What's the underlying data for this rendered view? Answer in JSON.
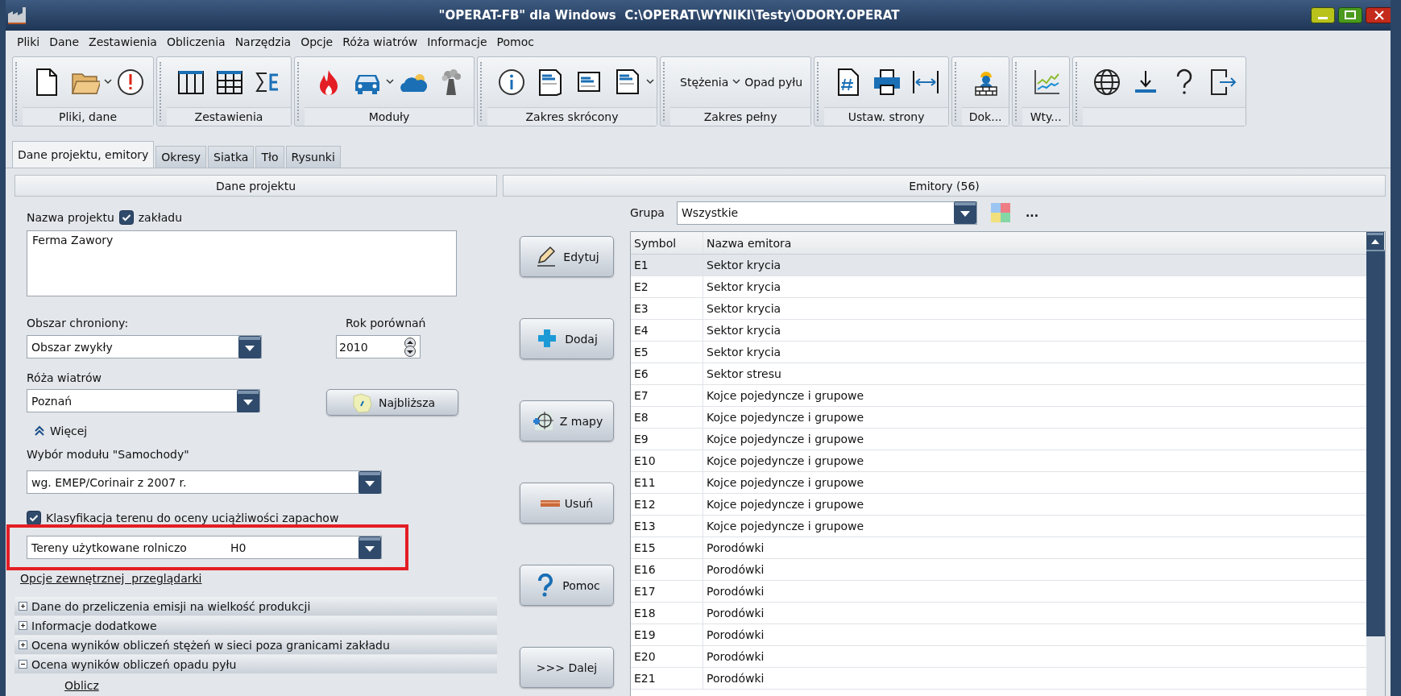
{
  "window": {
    "title": "\"OPERAT-FB\" dla Windows  C:\\OPERAT\\WYNIKI\\Testy\\ODORY.OPERAT"
  },
  "menu": [
    "Pliki",
    "Dane",
    "Zestawienia",
    "Obliczenia",
    "Narzędzia",
    "Opcje",
    "Róża wiatrów",
    "Informacje",
    "Pomoc"
  ],
  "toolbar": {
    "groups": [
      {
        "label": "Pliki, dane",
        "items": [
          {
            "kind": "icon"
          },
          {
            "kind": "icon"
          },
          {
            "kind": "caret"
          },
          {
            "kind": "icon"
          }
        ]
      },
      {
        "label": "Zestawienia",
        "items": [
          {
            "kind": "icon"
          },
          {
            "kind": "icon"
          },
          {
            "kind": "icon"
          }
        ]
      },
      {
        "label": "Moduły",
        "items": [
          {
            "kind": "icon"
          },
          {
            "kind": "icon"
          },
          {
            "kind": "caret"
          },
          {
            "kind": "icon"
          },
          {
            "kind": "icon"
          }
        ]
      },
      {
        "label": "Zakres skrócony",
        "items": [
          {
            "kind": "icon"
          },
          {
            "kind": "icon"
          },
          {
            "kind": "icon"
          },
          {
            "kind": "icon"
          },
          {
            "kind": "caret"
          }
        ]
      },
      {
        "label": "Zakres pełny",
        "items": [
          {
            "kind": "text",
            "label": "Stężenia"
          },
          {
            "kind": "caret"
          },
          {
            "kind": "text",
            "label": "Opad pyłu"
          }
        ]
      },
      {
        "label": "Ustaw. strony",
        "items": [
          {
            "kind": "icon"
          },
          {
            "kind": "icon"
          },
          {
            "kind": "icon"
          }
        ]
      },
      {
        "label": "Dok...",
        "items": [
          {
            "kind": "icon"
          }
        ]
      },
      {
        "label": "Wty...",
        "items": [
          {
            "kind": "icon"
          }
        ]
      },
      {
        "items": [
          {
            "kind": "icon"
          },
          {
            "kind": "icon"
          },
          {
            "kind": "icon"
          },
          {
            "kind": "icon"
          }
        ]
      }
    ]
  },
  "tabs": [
    {
      "label": "Dane projektu, emitory",
      "selected": true
    },
    {
      "label": "Okresy",
      "selected": false
    },
    {
      "label": "Siatka",
      "selected": false
    },
    {
      "label": "Tło",
      "selected": false
    },
    {
      "label": "Rysunki",
      "selected": false
    }
  ],
  "project": {
    "header": "Dane projektu",
    "name": {
      "label": "Nazwa projektu",
      "checkbox": {
        "label": "zakładu",
        "checked": true
      },
      "value": "Ferma Zawory"
    },
    "protected_area": {
      "label": "Obszar chroniony:",
      "value": "Obszar zwykły"
    },
    "comparison_year": {
      "label": "Rok porównań",
      "value": "2010"
    },
    "wind_rose": {
      "label": "Róża wiatrów",
      "value": "Poznań",
      "button": "Najbliższa"
    },
    "more": {
      "label": "Więcej",
      "expanded": true
    },
    "car_module": {
      "label": "Wybór modułu \"Samochody\"",
      "value": "wg. EMEP/Corinair z 2007 r."
    },
    "terrain": {
      "label": "Klasyfikacja terenu do oceny uciążliwości zapachow",
      "checked": true,
      "value": "Tereny użytkowane rolniczo",
      "code": "H0",
      "highlighted": true
    },
    "browser_link": "Opcje zewnętrznej  przeglądarki",
    "sections": [
      {
        "label": "Dane do przeliczenia emisji na wielkość produkcji",
        "expanded": false
      },
      {
        "label": "Informacje dodatkowe",
        "expanded": false
      },
      {
        "label": "Ocena wyników obliczeń stężeń w sieci poza granicami zakładu",
        "expanded": false
      },
      {
        "label": "Ocena wyników obliczeń opadu pyłu",
        "expanded": true,
        "links": [
          "Oblicz"
        ]
      }
    ]
  },
  "actions": [
    {
      "label": "Edytuj",
      "kind": "edit"
    },
    {
      "label": "Dodaj",
      "kind": "add"
    },
    {
      "label": "Z mapy",
      "kind": "map"
    },
    {
      "label": "Usuń",
      "kind": "delete"
    },
    {
      "label": "Pomoc",
      "kind": "help"
    },
    {
      "label": ">>> Dalej",
      "kind": "next"
    }
  ],
  "emitters": {
    "header": "Emitory (56)",
    "group": {
      "label": "Grupa",
      "value": "Wszystkie"
    },
    "more_button": "...",
    "table": {
      "columns": [
        "Symbol",
        "Nazwa emitora"
      ],
      "rows": [
        {
          "cells": [
            "E1",
            "Sektor krycia"
          ],
          "selected": true
        },
        {
          "cells": [
            "E2",
            "Sektor krycia"
          ],
          "selected": false
        },
        {
          "cells": [
            "E3",
            "Sektor krycia"
          ],
          "selected": false
        },
        {
          "cells": [
            "E4",
            "Sektor krycia"
          ],
          "selected": false
        },
        {
          "cells": [
            "E5",
            "Sektor krycia"
          ],
          "selected": false
        },
        {
          "cells": [
            "E6",
            "Sektor stresu"
          ],
          "selected": false
        },
        {
          "cells": [
            "E7",
            "Kojce pojedyncze i grupowe"
          ],
          "selected": false
        },
        {
          "cells": [
            "E8",
            "Kojce pojedyncze i grupowe"
          ],
          "selected": false
        },
        {
          "cells": [
            "E9",
            "Kojce pojedyncze i grupowe"
          ],
          "selected": false
        },
        {
          "cells": [
            "E10",
            "Kojce pojedyncze i grupowe"
          ],
          "selected": false
        },
        {
          "cells": [
            "E11",
            "Kojce pojedyncze i grupowe"
          ],
          "selected": false
        },
        {
          "cells": [
            "E12",
            "Kojce pojedyncze i grupowe"
          ],
          "selected": false
        },
        {
          "cells": [
            "E13",
            "Kojce pojedyncze i grupowe"
          ],
          "selected": false
        },
        {
          "cells": [
            "E15",
            "Porodówki"
          ],
          "selected": false
        },
        {
          "cells": [
            "E16",
            "Porodówki"
          ],
          "selected": false
        },
        {
          "cells": [
            "E17",
            "Porodówki"
          ],
          "selected": false
        },
        {
          "cells": [
            "E18",
            "Porodówki"
          ],
          "selected": false
        },
        {
          "cells": [
            "E19",
            "Porodówki"
          ],
          "selected": false
        },
        {
          "cells": [
            "E20",
            "Porodówki"
          ],
          "selected": false
        },
        {
          "cells": [
            "E21",
            "Porodówki"
          ],
          "selected": false
        }
      ]
    }
  }
}
